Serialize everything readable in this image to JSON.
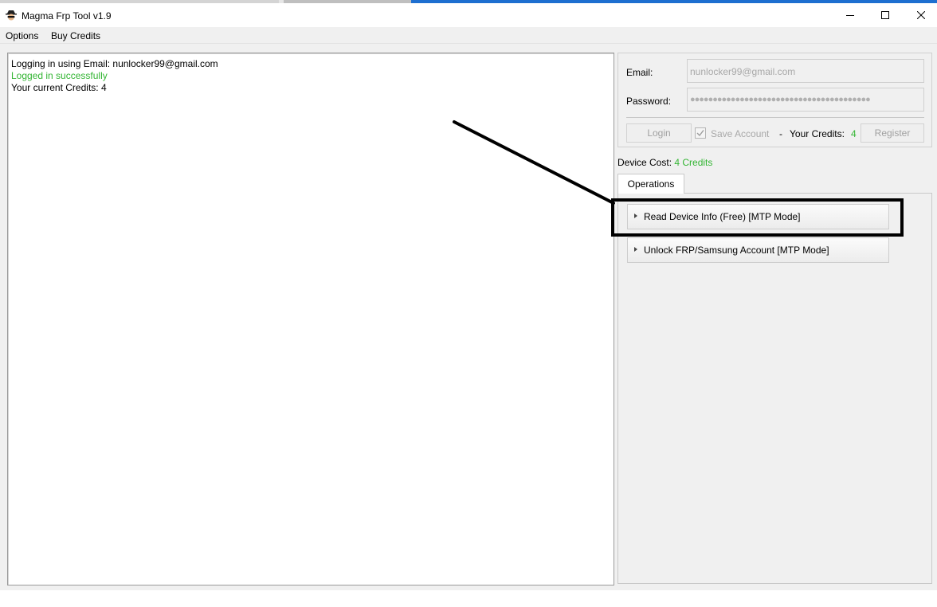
{
  "window": {
    "title": "Magma Frp Tool v1.9"
  },
  "menu": {
    "items": [
      "Options",
      "Buy Credits"
    ]
  },
  "log": {
    "lines": [
      {
        "text": "Logging in using Email: nunlocker99@gmail.com",
        "status": "info"
      },
      {
        "text": "Logged in successfully",
        "status": "success"
      },
      {
        "text": "Your current Credits: 4",
        "status": "info"
      }
    ]
  },
  "login": {
    "email_label": "Email:",
    "email_value": "nunlocker99@gmail.com",
    "password_label": "Password:",
    "password_value": "●●●●●●●●●●●●●●●●●●●●●●●●●●●●●●●●●●●●●●●●",
    "login_button": "Login",
    "save_account_label": "Save Account",
    "save_account_checked": true,
    "separator": "-",
    "credits_label": "Your Credits:",
    "credits_value": "4",
    "register_button": "Register"
  },
  "device_cost": {
    "label": "Device Cost:",
    "value": "4 Credits"
  },
  "tabs": [
    "Operations"
  ],
  "operations": [
    {
      "label": "Read Device Info (Free) [MTP Mode]"
    },
    {
      "label": "Unlock FRP/Samsung Account [MTP Mode]"
    }
  ],
  "colors": {
    "success": "#33b533",
    "highlight_box": "#000000"
  }
}
